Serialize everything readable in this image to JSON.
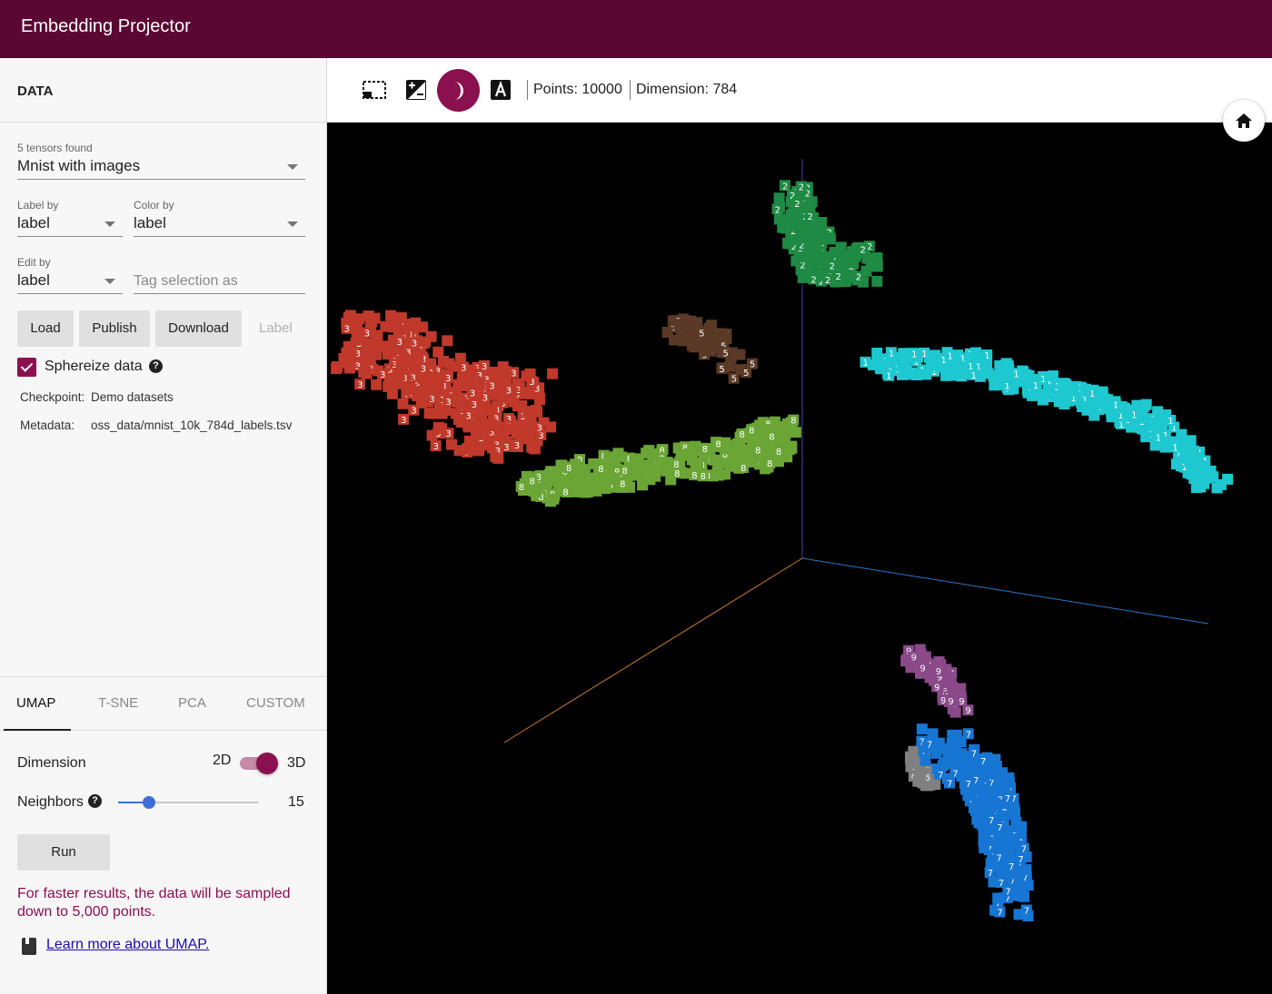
{
  "app": {
    "title": "Embedding Projector"
  },
  "data_panel": {
    "header": "DATA",
    "tensors_found": "5 tensors found",
    "tensor_select": "Mnist with images",
    "label_by": {
      "label": "Label by",
      "value": "label"
    },
    "color_by": {
      "label": "Color by",
      "value": "label"
    },
    "edit_by": {
      "label": "Edit by",
      "value": "label"
    },
    "tag_input_placeholder": "Tag selection as",
    "buttons": {
      "load": "Load",
      "publish": "Publish",
      "download": "Download",
      "label": "Label"
    },
    "sphereize": {
      "label": "Sphereize data",
      "checked": true
    },
    "checkpoint": {
      "key": "Checkpoint:",
      "value": "Demo datasets"
    },
    "metadata": {
      "key": "Metadata:",
      "value": "oss_data/mnist_10k_784d_labels.tsv"
    }
  },
  "projection_tabs": [
    "UMAP",
    "T-SNE",
    "PCA",
    "CUSTOM"
  ],
  "umap": {
    "dimension": {
      "label": "Dimension",
      "left": "2D",
      "right": "3D",
      "selected": "3D"
    },
    "neighbors": {
      "label": "Neighbors",
      "value": "15"
    },
    "run": "Run",
    "warning": "For faster results, the data will be sampled down to 5,000 points.",
    "learn_more": "Learn more about UMAP."
  },
  "toolbar": {
    "points": "Points: 10000",
    "dimension": "Dimension: 784",
    "night_mode_active": true
  },
  "icons": [
    "select-box-icon",
    "contrast-icon",
    "night-mode-icon",
    "label-a-icon",
    "home-icon",
    "help-icon",
    "book-icon"
  ],
  "colors": {
    "app_bar": "#5a0833",
    "accent": "#8a1050",
    "slider": "#3e6fd6",
    "digit_3": "#c0392b",
    "digit_8": "#6aa536",
    "digit_2": "#1e8a44",
    "digit_1": "#1ec8d0",
    "digit_7": "#1776d4",
    "digit_9": "#8a4a8a",
    "digit_5": "#5a3a26",
    "digit_6": "#808080"
  }
}
